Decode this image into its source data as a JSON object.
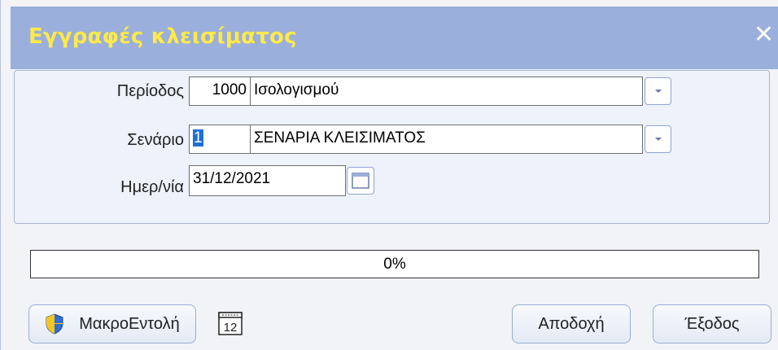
{
  "window": {
    "title": "Εγγραφές κλεισίματος",
    "close_glyph": "✕"
  },
  "form": {
    "period": {
      "label": "Περίοδος",
      "code": "1000",
      "description": "Ισολογισμού"
    },
    "scenario": {
      "label": "Σενάριο",
      "code": "1",
      "description": "ΣΕΝΑΡΙΑ ΚΛΕΙΣΙΜΑΤΟΣ"
    },
    "date": {
      "label": "Ημερ/νία",
      "value": "31/12/2021"
    }
  },
  "progress": {
    "value": 0,
    "label": "0%"
  },
  "buttons": {
    "macro_label": "ΜακροΕντολή",
    "calendar_day": "12",
    "accept_label": "Αποδοχή",
    "exit_label": "Έξοδος"
  },
  "colors": {
    "titlebar": "#9aafdb",
    "title_text": "#ffe94a",
    "selection": "#1f6fd6"
  },
  "icons": {
    "close": "close-icon",
    "dropdown": "chevron-down-icon",
    "date_picker": "calendar-icon",
    "macro": "shield-icon",
    "schedule": "calendar-icon"
  }
}
